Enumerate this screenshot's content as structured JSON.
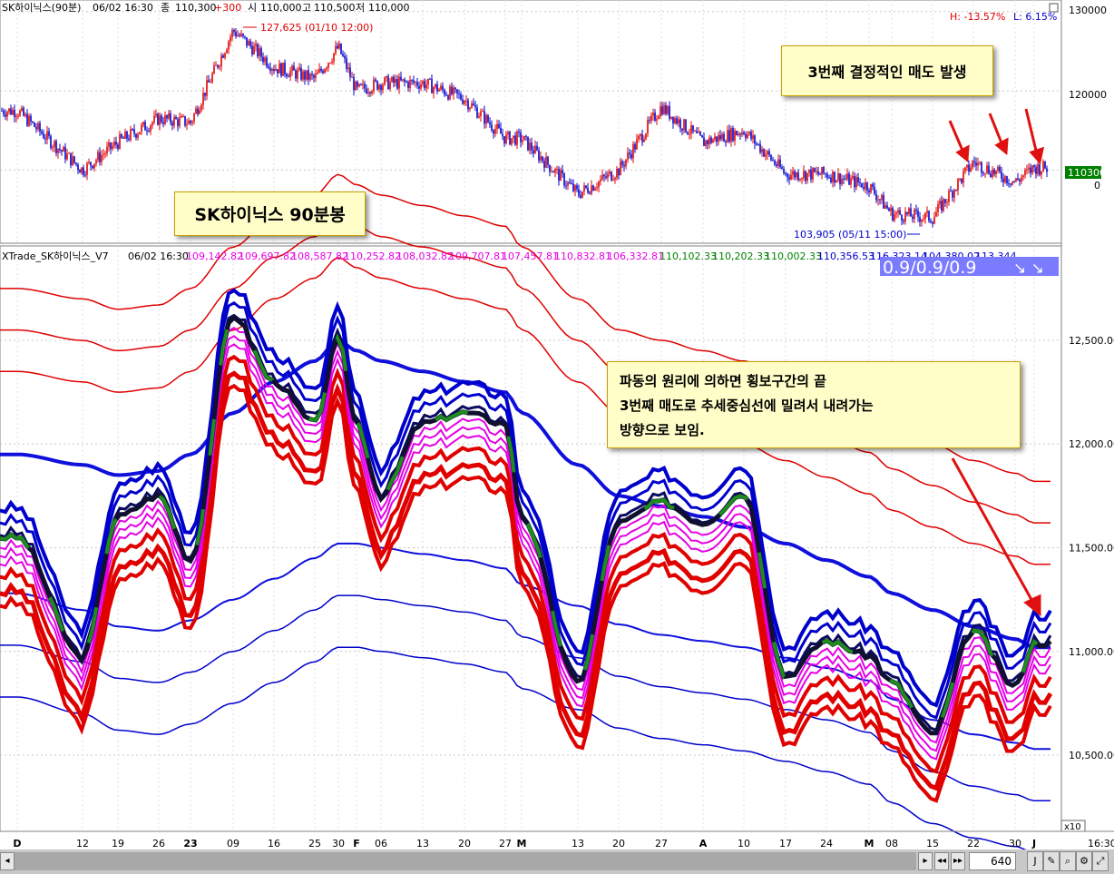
{
  "header": {
    "symbol": "SK하이닉스(90분)",
    "datetime": "06/02 16:30",
    "close_label": "종",
    "close": "110,300",
    "change": "+300",
    "open_label": "시",
    "open": "110,000",
    "high_label": "고",
    "high": "110,500",
    "low_label": "저",
    "low": "110,000",
    "h_pct": "H: -13.57%",
    "l_pct": "L: 6.15%"
  },
  "annotations": {
    "high_marker": "127,625 (01/10 12:00)",
    "low_marker": "103,905 (05/11 15:00)",
    "third_sell": "3번째 결정적인 매도 발생",
    "title_box": "SK하이닉스 90분봉",
    "wave_line1": "파동의 원리에 의하면 횡보구간의 끝",
    "wave_line2": "3번째 매도로 추세중심선에 밀려서 내려가는",
    "wave_line3": "방향으로 보임."
  },
  "price_axis": {
    "ticks": [
      "130000",
      "120000",
      "0"
    ],
    "current": "110300",
    "zero": "0"
  },
  "indicator": {
    "name": "XTrade_SK하이닉스_V7",
    "datetime": "06/02 16:30",
    "values_pink": [
      "109,142.82",
      "109,697.82",
      "108,587.82",
      "110,252.82",
      "108,032.82",
      "109,707.81",
      "107,457.81",
      "110,832.81",
      "106,332.81"
    ],
    "values_green": [
      "110,102.33",
      "110,202.33",
      "110,002.33"
    ],
    "values_blue": [
      "110,356.53",
      "116,323.14",
      "104,380.02",
      "113,344"
    ],
    "badge": "0.9/0.9/0.9",
    "badge_arrows": "↘ ↘",
    "ticks": [
      "12,500.00",
      "12,000.00",
      "11,500.00",
      "11,000.00",
      "10,500.00"
    ],
    "scale": "x10"
  },
  "time_axis": {
    "labels": [
      "D",
      "12",
      "19",
      "26",
      "23",
      "09",
      "16",
      "25",
      "30",
      "F",
      "06",
      "13",
      "20",
      "27",
      "M",
      "13",
      "20",
      "27",
      "A",
      "10",
      "17",
      "24",
      "M",
      "08",
      "15",
      "22",
      "30",
      "J"
    ],
    "time": "16:30"
  },
  "bottom_bar": {
    "zoom": "640"
  },
  "colors": {
    "up": "#e00000",
    "down": "#0000cc",
    "pink": "#e600e6",
    "green": "#008000",
    "badge_bg": "#7b7bff"
  },
  "chart_data": [
    {
      "type": "line",
      "title": "SK하이닉스(90분)",
      "xlabel": "",
      "ylabel": "",
      "ylim": [
        101000,
        131000
      ],
      "x": [
        "D",
        "12",
        "19",
        "26",
        "23",
        "09",
        "16",
        "25",
        "30",
        "F",
        "06",
        "13",
        "20",
        "27",
        "M",
        "13",
        "20",
        "27",
        "A",
        "10",
        "17",
        "24",
        "M",
        "08",
        "15",
        "22",
        "30",
        "J"
      ],
      "series": [
        {
          "name": "",
          "values": [
            117500,
            110000,
            113500,
            116500,
            116000,
            127625,
            123000,
            121500,
            125500,
            120000,
            121000,
            121000,
            119000,
            114000,
            114000,
            107000,
            110000,
            118000,
            113500,
            115000,
            109500,
            109500,
            108000,
            104500,
            104000,
            111000,
            108500,
            110300
          ]
        }
      ],
      "grid": true
    },
    {
      "type": "line",
      "title": "XTrade_SK하이닉스_V7",
      "xlabel": "",
      "ylabel": "",
      "ylim": [
        10150,
        12850
      ],
      "x": [
        "D",
        "12",
        "19",
        "26",
        "23",
        "09",
        "16",
        "25",
        "30",
        "F",
        "06",
        "13",
        "20",
        "27",
        "M",
        "13",
        "20",
        "27",
        "A",
        "10",
        "17",
        "24",
        "M",
        "08",
        "15",
        "22",
        "30",
        "J"
      ],
      "series": [
        {
          "name": "",
          "values": [
            11550,
            10970,
            11650,
            11750,
            11440,
            12620,
            12300,
            12100,
            12500,
            12100,
            11750,
            12100,
            12150,
            12100,
            11650,
            10850,
            11620,
            11720,
            11620,
            11760,
            10880,
            11050,
            10980,
            10850,
            10600,
            11100,
            10830,
            11040
          ]
        },
        {
          "name": "",
          "values": [
            11950,
            11900,
            11850,
            11870,
            11950,
            12150,
            12300,
            12400,
            12500,
            12450,
            12400,
            12350,
            12300,
            12250,
            12150,
            11900,
            11750,
            11700,
            11650,
            11600,
            11520,
            11440,
            11360,
            11280,
            11200,
            11120,
            11060,
            11020
          ]
        },
        {
          "name": "",
          "values": [
            11280,
            11200,
            11120,
            11100,
            11150,
            11250,
            11350,
            11450,
            11520,
            11520,
            11500,
            11470,
            11440,
            11400,
            11320,
            11220,
            11130,
            11080,
            11050,
            11020,
            10970,
            10920,
            10860,
            10770,
            10670,
            10600,
            10560,
            10530
          ]
        }
      ],
      "grid": true
    }
  ]
}
